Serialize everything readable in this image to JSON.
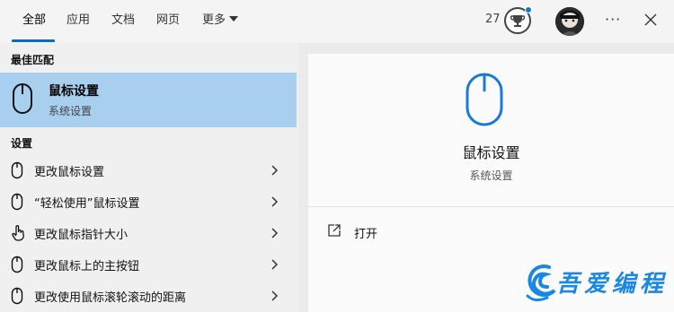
{
  "tabs": [
    {
      "label": "全部",
      "active": true
    },
    {
      "label": "应用"
    },
    {
      "label": "文档"
    },
    {
      "label": "网页"
    },
    {
      "label": "更多"
    }
  ],
  "header": {
    "points": "27",
    "trophy_icon": "trophy-icon",
    "more_icon": "more-icon",
    "more_glyph": "···",
    "close_icon": "close-icon"
  },
  "best_match": {
    "section": "最佳匹配",
    "title": "鼠标设置",
    "subtitle": "系统设置",
    "icon": "mouse-icon"
  },
  "settings": {
    "section": "设置",
    "items": [
      {
        "label": "更改鼠标设置",
        "icon": "mouse-icon"
      },
      {
        "label": "“轻松使用”鼠标设置",
        "icon": "mouse-icon"
      },
      {
        "label": "更改鼠标指针大小",
        "icon": "pointer-hand-icon"
      },
      {
        "label": "更改鼠标上的主按钮",
        "icon": "mouse-icon"
      },
      {
        "label": "更改使用鼠标滚轮滚动的距离",
        "icon": "mouse-icon"
      }
    ]
  },
  "detail": {
    "title": "鼠标设置",
    "subtitle": "系统设置",
    "icon": "mouse-icon",
    "actions": [
      {
        "label": "打开",
        "icon": "open-icon"
      }
    ]
  },
  "watermark": {
    "text": "吾爱编程"
  },
  "colors": {
    "accent": "#0a6cc7",
    "selection": "#a8cfee",
    "watermark": "#1a87e3"
  }
}
